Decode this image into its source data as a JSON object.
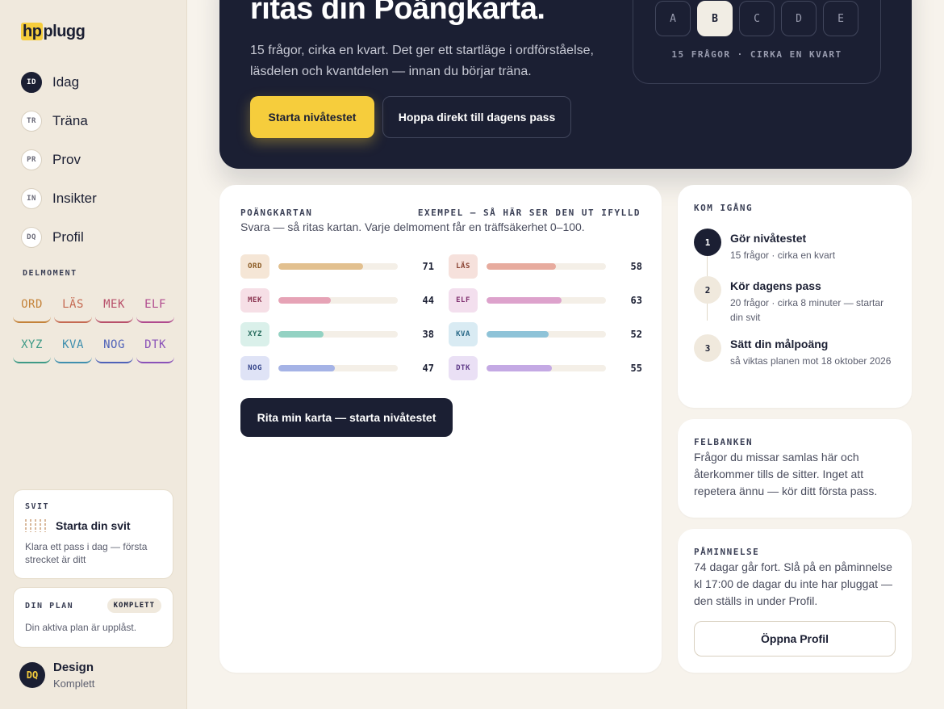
{
  "app": {
    "brand_hp": "hp",
    "brand_rest": "plugg"
  },
  "nav": [
    {
      "code": "ID",
      "label": "Idag",
      "active": true
    },
    {
      "code": "TR",
      "label": "Träna"
    },
    {
      "code": "PR",
      "label": "Prov"
    },
    {
      "code": "IN",
      "label": "Insikter"
    },
    {
      "code": "DQ",
      "label": "Profil"
    }
  ],
  "delmoment": {
    "title": "DELMOMENT",
    "chips": [
      {
        "label": "ORD",
        "color": "#c4833a"
      },
      {
        "label": "LÄS",
        "color": "#c56a52"
      },
      {
        "label": "MEK",
        "color": "#b8506a"
      },
      {
        "label": "ELF",
        "color": "#b04a8e"
      },
      {
        "label": "XYZ",
        "color": "#3e9a86"
      },
      {
        "label": "KVA",
        "color": "#3f8fae"
      },
      {
        "label": "NOG",
        "color": "#4f62b8"
      },
      {
        "label": "DTK",
        "color": "#8a52b8"
      }
    ]
  },
  "svit": {
    "kicker": "SVIT",
    "title": "Starta din svit",
    "desc": "Klara ett pass i dag — första strecket är ditt"
  },
  "plan": {
    "kicker": "DIN PLAN",
    "badge": "KOMPLETT",
    "desc": "Din aktiva plan är upplåst."
  },
  "user": {
    "initials": "DQ",
    "name": "Design",
    "sub": "Komplett"
  },
  "hero": {
    "title": "ritas din Poängkarta.",
    "desc": "15 frågor, cirka en kvart. Det ger ett startläge i ordförståelse, läsdelen och kvantdelen — innan du börjar träna.",
    "primary": "Starta nivåtestet",
    "secondary": "Hoppa direkt till dagens pass",
    "options": [
      "A",
      "B",
      "C",
      "D",
      "E"
    ],
    "selected_option": "B",
    "caption": "15 FRÅGOR · CIRKA EN KVART"
  },
  "map": {
    "kicker": "POÄNGKARTAN",
    "example": "EXEMPEL — SÅ HÄR SER DEN UT IFYLLD",
    "desc": "Svara — så ritas kartan. Varje delmoment får en träffsäkerhet 0–100.",
    "cta": "Rita min karta — starta nivåtestet",
    "scores": [
      {
        "label": "ORD",
        "value": 71,
        "bg": "#f5e6d6",
        "fg": "#8a5a22",
        "fill": "#e2c08f"
      },
      {
        "label": "LÄS",
        "value": 58,
        "bg": "#f6e1dc",
        "fg": "#8a4232",
        "fill": "#e7ab9e"
      },
      {
        "label": "MEK",
        "value": 44,
        "bg": "#f6dfe6",
        "fg": "#8a3450",
        "fill": "#e6a3b6"
      },
      {
        "label": "ELF",
        "value": 63,
        "bg": "#f3dfee",
        "fg": "#803070",
        "fill": "#dda2cc"
      },
      {
        "label": "XYZ",
        "value": 38,
        "bg": "#daf0ea",
        "fg": "#2a6e60",
        "fill": "#93d2c3"
      },
      {
        "label": "KVA",
        "value": 52,
        "bg": "#d9ebf3",
        "fg": "#2a6a88",
        "fill": "#8ec3d8"
      },
      {
        "label": "NOG",
        "value": 47,
        "bg": "#dfe3f6",
        "fg": "#34448a",
        "fill": "#a5b3e6"
      },
      {
        "label": "DTK",
        "value": 55,
        "bg": "#eae0f5",
        "fg": "#5e3a88",
        "fill": "#c4a9e4"
      }
    ]
  },
  "start": {
    "kicker": "KOM IGÅNG",
    "steps": [
      {
        "num": "1",
        "title": "Gör nivåtestet",
        "sub": "15 frågor · cirka en kvart"
      },
      {
        "num": "2",
        "title": "Kör dagens pass",
        "sub": "20 frågor · cirka 8 minuter — startar din svit"
      },
      {
        "num": "3",
        "title": "Sätt din målpoäng",
        "sub": "så viktas planen mot 18 oktober 2026"
      }
    ]
  },
  "felbanken": {
    "kicker": "FELBANKEN",
    "text": "Frågor du missar samlas här och återkommer tills de sitter. Inget att repetera ännu — kör ditt första pass."
  },
  "reminder": {
    "kicker": "PÅMINNELSE",
    "text": "74 dagar går fort. Slå på en påminnelse kl 17:00 de dagar du inte har pluggat — den ställs in under Profil.",
    "button": "Öppna Profil"
  }
}
